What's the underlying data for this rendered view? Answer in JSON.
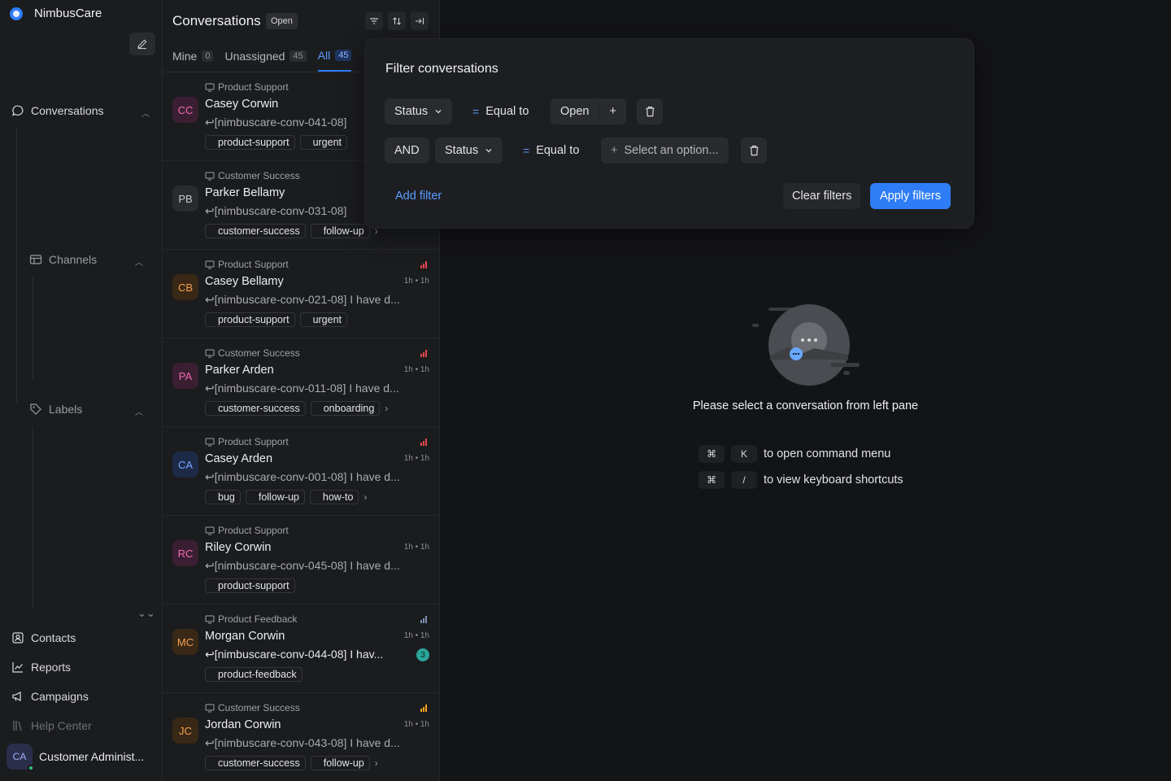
{
  "sidebar": {
    "brand": "NimbusCare",
    "nav": {
      "conversations": "Conversations",
      "channels": "Channels",
      "labels": "Labels",
      "contacts": "Contacts",
      "reports": "Reports",
      "campaigns": "Campaigns",
      "help_center": "Help Center"
    },
    "user": {
      "initials": "CA",
      "name": "Customer Administ...",
      "status_color": "#35c286"
    }
  },
  "list": {
    "title": "Conversations",
    "status": "Open",
    "tabs": [
      {
        "label": "Mine",
        "count": "0"
      },
      {
        "label": "Unassigned",
        "count": "45"
      },
      {
        "label": "All",
        "count": "45",
        "active": true
      }
    ],
    "conversations": [
      {
        "initials": "CC",
        "inbox": "Product Support",
        "name": "Casey Corwin",
        "message": "[nimbuscare-conv-041-08]",
        "labels": [
          "product-support",
          "urgent"
        ],
        "priority": "urgent",
        "time": "",
        "avatar_bg": "#3a1f33",
        "avatar_fg": "#f06ab0"
      },
      {
        "initials": "PB",
        "inbox": "Customer Success",
        "name": "Parker Bellamy",
        "message": "[nimbuscare-conv-031-08]",
        "labels": [
          "customer-success",
          "follow-up"
        ],
        "more": "›",
        "priority": "",
        "time": "",
        "avatar_bg": "#2a2b2e",
        "avatar_fg": "#c8cacd"
      },
      {
        "initials": "CB",
        "inbox": "Product Support",
        "name": "Casey Bellamy",
        "message": "[nimbuscare-conv-021-08] I have d...",
        "labels": [
          "product-support",
          "urgent"
        ],
        "priority": "urgent",
        "time": "1h • 1h",
        "avatar_bg": "#3a2816",
        "avatar_fg": "#f3a150"
      },
      {
        "initials": "PA",
        "inbox": "Customer Success",
        "name": "Parker Arden",
        "message": "[nimbuscare-conv-011-08] I have d...",
        "labels": [
          "customer-success",
          "onboarding"
        ],
        "more": "›",
        "priority": "urgent",
        "time": "1h • 1h",
        "avatar_bg": "#3a1f33",
        "avatar_fg": "#f06ab0"
      },
      {
        "initials": "CA",
        "inbox": "Product Support",
        "name": "Casey Arden",
        "message": "[nimbuscare-conv-001-08] I have d...",
        "labels": [
          "bug",
          "follow-up",
          "how-to"
        ],
        "more": "›",
        "priority": "urgent",
        "time": "1h • 1h",
        "avatar_bg": "#1c2a48",
        "avatar_fg": "#7aa5ff"
      },
      {
        "initials": "RC",
        "inbox": "Product Support",
        "name": "Riley Corwin",
        "message": "[nimbuscare-conv-045-08] I have d...",
        "labels": [
          "product-support"
        ],
        "priority": "",
        "time": "1h • 1h",
        "avatar_bg": "#3a1f33",
        "avatar_fg": "#f06ab0"
      },
      {
        "initials": "MC",
        "inbox": "Product Feedback",
        "name": "Morgan Corwin",
        "message": "[nimbuscare-conv-044-08] I hav...",
        "bold": true,
        "unread": "3",
        "labels": [
          "product-feedback"
        ],
        "priority": "low",
        "time": "1h • 1h",
        "avatar_bg": "#3a2816",
        "avatar_fg": "#f3a150"
      },
      {
        "initials": "JC",
        "inbox": "Customer Success",
        "name": "Jordan Corwin",
        "message": "[nimbuscare-conv-043-08] I have d...",
        "labels": [
          "customer-success",
          "follow-up"
        ],
        "more": "›",
        "priority": "medium",
        "time": "1h • 1h",
        "avatar_bg": "#3a2816",
        "avatar_fg": "#f3a150"
      }
    ]
  },
  "main": {
    "empty_text": "Please select a conversation from left pane",
    "shortcuts": [
      {
        "key1": "⌘",
        "key2": "K",
        "text": "to open command menu"
      },
      {
        "key1": "⌘",
        "key2": "/",
        "text": "to view keyboard shortcuts"
      }
    ]
  },
  "filter": {
    "title": "Filter conversations",
    "row1": {
      "attribute": "Status",
      "operator": "Equal to",
      "value": "Open",
      "add": "+"
    },
    "row2": {
      "conjunction": "AND",
      "attribute": "Status",
      "operator": "Equal to",
      "placeholder": "Select an option..."
    },
    "add_filter": "Add filter",
    "clear": "Clear filters",
    "apply": "Apply filters"
  },
  "colors": {
    "accent": "#2f7df6",
    "urgent": "#e5484d",
    "medium": "#f5a524",
    "low": "#7d8fb3"
  }
}
